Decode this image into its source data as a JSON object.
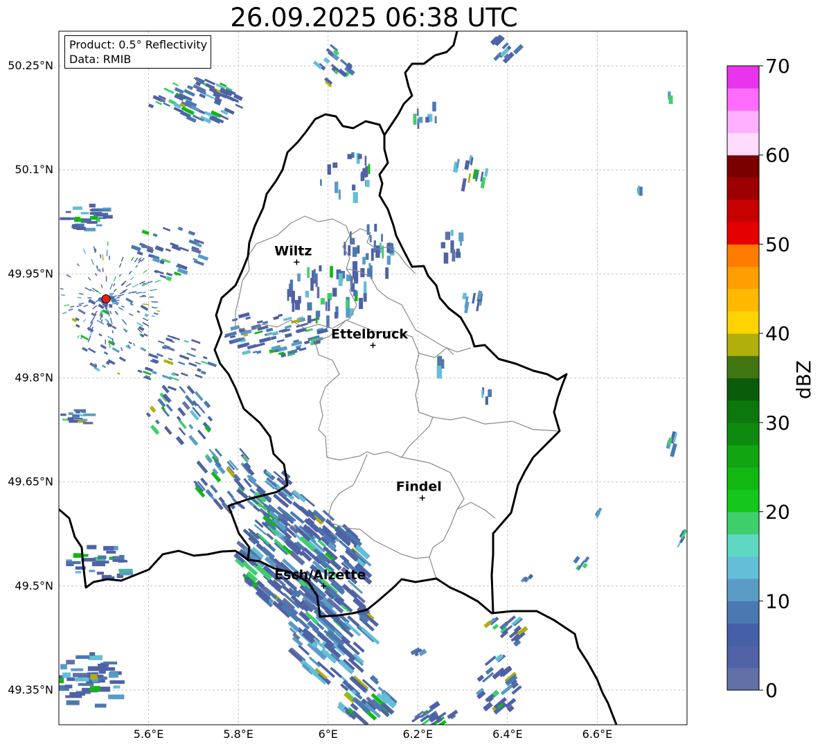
{
  "title": "26.09.2025 06:38 UTC",
  "info_box": {
    "product": "Product: 0.5° Reflectivity",
    "data": "Data: RMIB"
  },
  "map": {
    "lon_range": [
      5.4,
      6.8
    ],
    "lat_range": [
      49.3,
      50.3
    ],
    "x_ticks": [
      "5.6°E",
      "5.8°E",
      "6°E",
      "6.2°E",
      "6.4°E",
      "6.6°E"
    ],
    "y_ticks": [
      "50.25°N",
      "50.1°N",
      "49.95°N",
      "49.8°N",
      "49.65°N",
      "49.5°N",
      "49.35°N"
    ],
    "grid": true,
    "cities": [
      {
        "name": "Wiltz",
        "lon": 5.93,
        "lat": 49.967
      },
      {
        "name": "Ettelbruck",
        "lon": 6.1,
        "lat": 49.847
      },
      {
        "name": "Findel",
        "lon": 6.21,
        "lat": 49.627
      },
      {
        "name": "Esch/Alzette",
        "lon": 5.99,
        "lat": 49.5
      }
    ],
    "radar_site": {
      "lon": 5.505,
      "lat": 49.914,
      "color": "#e8201a"
    }
  },
  "colorbar": {
    "label": "dBZ",
    "ticks": [
      "0",
      "10",
      "20",
      "30",
      "40",
      "50",
      "60",
      "70"
    ],
    "range": [
      0,
      70
    ],
    "colors": [
      "#6270a8",
      "#4f62a5",
      "#4560a6",
      "#4b78b0",
      "#5a9bc6",
      "#63bfd7",
      "#5ed8c2",
      "#3ecf6a",
      "#14c71a",
      "#12b812",
      "#11a511",
      "#0e8b0e",
      "#0c770c",
      "#0a5c0a",
      "#417511",
      "#afb00b",
      "#ffd300",
      "#ffb900",
      "#ff9e00",
      "#ff7c00",
      "#e50000",
      "#c70000",
      "#9c0000",
      "#7a0000",
      "#ffdcff",
      "#ffb0ff",
      "#ff6cff",
      "#e834ec"
    ]
  }
}
